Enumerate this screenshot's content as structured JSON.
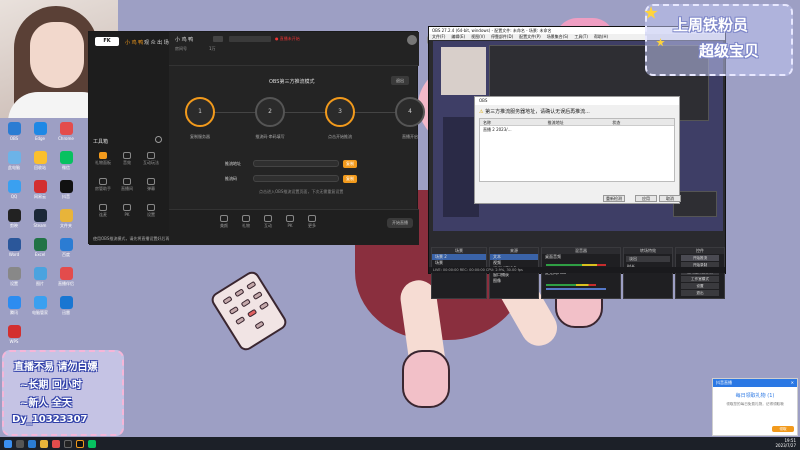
{
  "streamTool": {
    "tabs": [
      "小 鸡 鸭",
      "观 众 出 场"
    ],
    "roomInfo": "房间号",
    "uploadCount": "1万",
    "header": "OBS第三方推流模式",
    "headerBtn": "退出",
    "steps": [
      {
        "n": "1",
        "label": "复制服务器"
      },
      {
        "n": "2",
        "label": "推流码·串码填写"
      },
      {
        "n": "3",
        "label": "点击开始推流"
      },
      {
        "n": "4",
        "label": "直播开启"
      }
    ],
    "fields": [
      {
        "label": "推流地址",
        "btn": "复制"
      },
      {
        "label": "推流码",
        "btn": "复制"
      }
    ],
    "hint": "点击进入OBS推流设置页面，下次无需重复设置",
    "sidebarTitle": "工具箱",
    "sidebarItems": [
      "礼物面板",
      "音效",
      "互动玩法",
      "房管助手",
      "直播间",
      "弹幕",
      "连麦",
      "PK",
      "设置"
    ],
    "bottomIcons": [
      "美颜",
      "礼物",
      "互动",
      "PK",
      "更多"
    ],
    "startBtn": "开始直播",
    "notice": "使用OBS推流模式，请先将直播设置好后再点击推流"
  },
  "obs": {
    "title": "OBS 27.2.4 (64-bit, windows) - 配置文件: 未命名 - 场景: 未命名",
    "menu": [
      "文件(F)",
      "编辑(E)",
      "视图(V)",
      "停靠部件(D)",
      "配置文件(P)",
      "场景集合(S)",
      "工具(T)",
      "帮助(H)"
    ],
    "dialog": {
      "title": "OBS",
      "warning": "第三方推流服务器地址，请确认无误后再推流...",
      "columns": [
        "名称",
        "推流地址",
        "状态"
      ],
      "rows": [
        [
          "直播 2  2023/…",
          "",
          ""
        ]
      ],
      "buttons": [
        "重新检测",
        "应用",
        "取消"
      ]
    },
    "docks": {
      "scenes": {
        "title": "场景",
        "items": [
          "场景 2",
          "场景"
        ]
      },
      "sources": {
        "title": "来源",
        "items": [
          "文本",
          "视频",
          "视频捕获设备",
          "窗口捕获",
          "图像"
        ]
      },
      "mixer": {
        "title": "混音器",
        "items": [
          "桌面音频",
          "麦克风/Aux"
        ]
      },
      "transitions": {
        "title": "转场特效",
        "items": [
          "淡出",
          "时长"
        ]
      },
      "controls": {
        "title": "控件",
        "items": [
          "开始推流",
          "开始录制",
          "启动虚拟摄像机",
          "工作室模式",
          "设置",
          "退出"
        ]
      }
    },
    "status": "LIVE: 00:00:00   REC: 00:00:00   CPU: 2.9%, 30.00 fps"
  },
  "badge": {
    "line1": "上周铁粉员",
    "line2": "超级宝贝"
  },
  "note": {
    "line1": "直播不易 请勿白嫖",
    "line2": "~长期 回小时",
    "line3": "~新人 全天",
    "line4": "Dy_10323307"
  },
  "toast": {
    "header": "抖音直播",
    "title": "每日领取礼物 (1)",
    "body": "领取您的每日免费礼物，记得领取哦",
    "btn": "领取"
  },
  "desktopIcons": [
    "OBS",
    "Edge",
    "Chrome",
    "此电脑",
    "回收站",
    "微信",
    "QQ",
    "网易云",
    "抖音",
    "剪映",
    "Steam",
    "文件夹",
    "Word",
    "Excel",
    "百度",
    "设置",
    "图片",
    "直播伴侣",
    "腾讯",
    "电脑管家",
    "迅雷",
    "WPS"
  ],
  "clock": {
    "time": "19:51",
    "date": "2023/7/27"
  }
}
